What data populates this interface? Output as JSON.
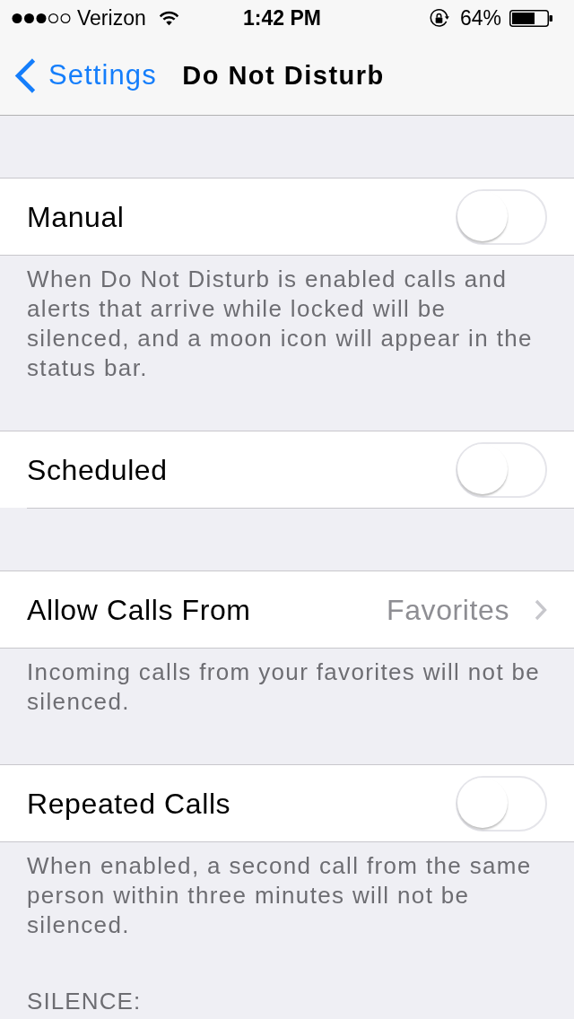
{
  "status_bar": {
    "carrier": "Verizon",
    "time": "1:42 PM",
    "battery": "64%"
  },
  "nav_bar": {
    "back_label": "Settings",
    "title": "Do Not Disturb"
  },
  "groups": [
    {
      "rows": [
        {
          "kind": "toggle",
          "label": "Manual",
          "on": false
        }
      ],
      "footer": "When Do Not Disturb is enabled calls and alerts that arrive while locked will be silenced, and a moon icon will appear in the status bar."
    },
    {
      "rows": [
        {
          "kind": "toggle",
          "label": "Scheduled",
          "on": false
        }
      ]
    },
    {
      "rows": [
        {
          "kind": "disclosure",
          "label": "Allow Calls From",
          "value": "Favorites"
        }
      ],
      "footer": "Incoming calls from your favorites will not be silenced."
    },
    {
      "rows": [
        {
          "kind": "toggle",
          "label": "Repeated Calls",
          "on": false
        }
      ],
      "footer": "When enabled, a second call from the same person within three minutes will not be silenced."
    },
    {
      "header": "SILENCE:"
    }
  ]
}
